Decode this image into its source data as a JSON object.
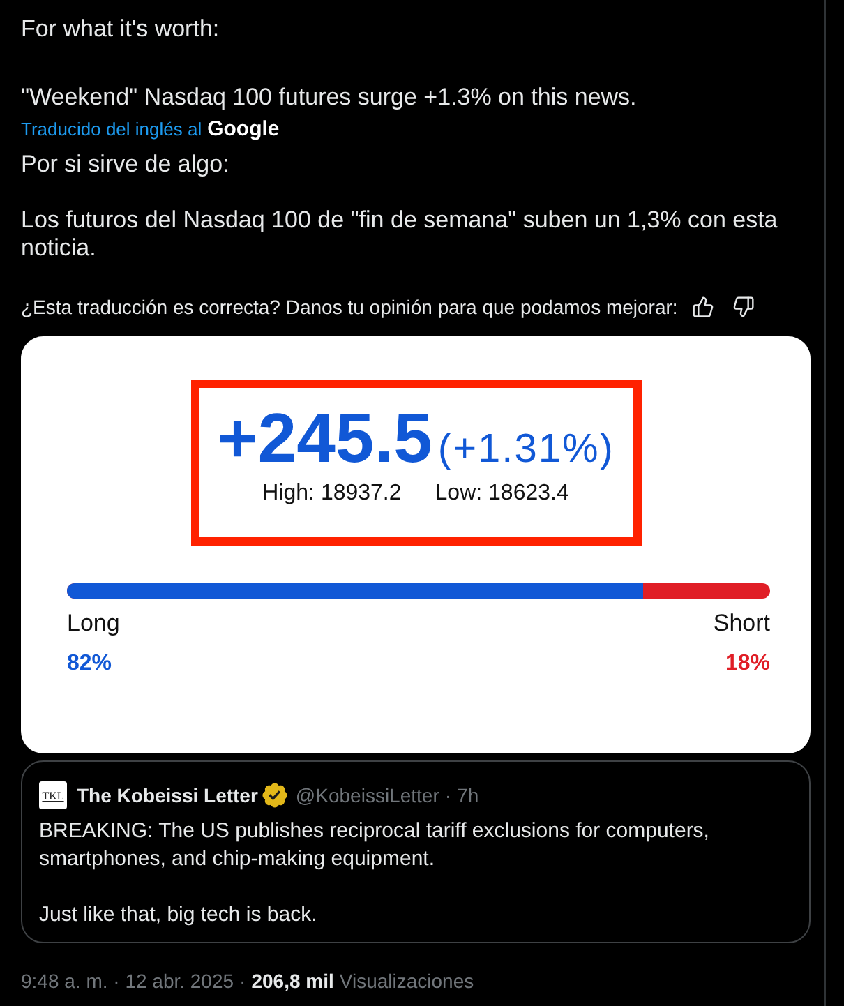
{
  "post": {
    "paragraphs": [
      "For what it's worth:",
      "\"Weekend\" Nasdaq 100 futures surge +1.3% on this news."
    ]
  },
  "translation": {
    "note": "Traducido del inglés al",
    "provider": "Google",
    "paragraphs": [
      "Por si sirve de algo:",
      "Los futuros del Nasdaq 100 de \"fin de semana\" suben un 1,3% con esta noticia."
    ],
    "feedback_prompt": "¿Esta traducción es correcta? Danos tu opinión para que podamos mejorar:"
  },
  "image": {
    "change": "+245.5",
    "change_percent": "(+1.31%)",
    "high": "High: 18937.2",
    "low": "Low: 18623.4",
    "sentiment": {
      "level": 0.82,
      "long_label": "Long",
      "long_value": "82%",
      "short_label": "Short",
      "short_value": "18%"
    }
  },
  "quoted_post": {
    "avatar_text": "TKL",
    "author": "The Kobeissi Letter",
    "verified": true,
    "handle": "@KobeissiLetter",
    "separator": "·",
    "time": "7h",
    "paragraphs": [
      "BREAKING: The US publishes reciprocal tariff exclusions for computers, smartphones, and chip-making equipment.",
      "Just like that, big tech is back."
    ]
  },
  "meta": {
    "timestamp": "9:48 a. m. · 12 abr. 2025",
    "separator": "·",
    "views_count": "206,8 mil",
    "views_label": "Visualizaciones"
  }
}
